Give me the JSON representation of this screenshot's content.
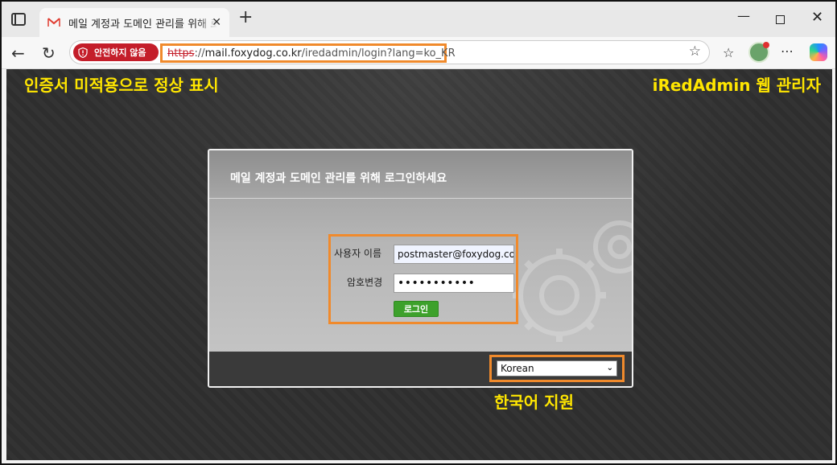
{
  "browser": {
    "tab_title": "메일 계정과 도메인 관리를 위해 로그인하세요",
    "insecure_label": "안전하지 않음",
    "url_scheme": "https",
    "url_sep": "://",
    "url_host": "mail.foxydog.co.kr",
    "url_path": "/iredadmin/login?lang=ko_KR"
  },
  "annotations": {
    "left": "인증서 미적용으로 정상 표시",
    "right": "iRedAdmin 웹 관리자",
    "bottom": "한국어 지원"
  },
  "login": {
    "title": "메일 계정과 도메인 관리를 위해 로그인하세요",
    "username_label": "사용자 이름",
    "username_value": "postmaster@foxydog.co",
    "password_label": "암호변경",
    "password_value": "•••••••••••",
    "login_button": "로그인"
  },
  "language": {
    "selected": "Korean"
  },
  "colors": {
    "highlight": "#f08a2c",
    "annotation": "#ffe600",
    "insecure": "#c41e2a",
    "button": "#3da12b"
  },
  "icons": [
    "sidebar-icon",
    "mail-favicon-icon",
    "close-icon",
    "plus-icon",
    "back-icon",
    "reload-icon",
    "shield-icon",
    "star-icon",
    "favorites-icon",
    "avatar",
    "more-icon",
    "copilot-icon",
    "gear-icon",
    "chevron-down-icon"
  ]
}
